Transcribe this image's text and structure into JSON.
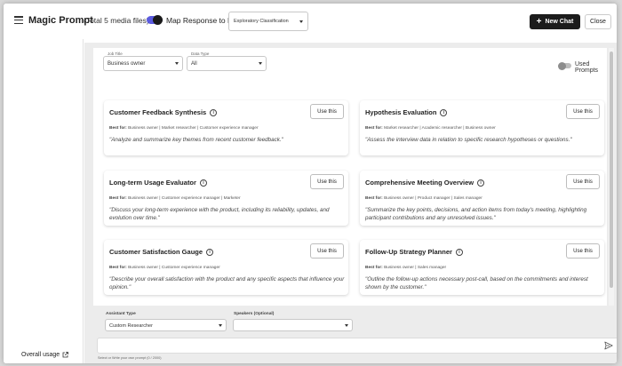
{
  "header": {
    "title": "Magic Prompt",
    "count": "(Total 5 media files)",
    "map_label": "Map Response to Field",
    "field_select": "Exploratory Classification",
    "new_chat": "New Chat",
    "close": "Close"
  },
  "sidebar": {
    "overall_usage": "Overall usage"
  },
  "filters": {
    "job_title_label": "Job Title",
    "job_title_value": "Business owner",
    "data_type_label": "Data Type",
    "data_type_value": "All",
    "used_prompts": "Used Prompts"
  },
  "common": {
    "use_label": "Use this",
    "best_for_label": "Best for:"
  },
  "cards": [
    {
      "title": "Customer Feedback Synthesis",
      "best_for": "Business owner | Market researcher | Customer experience manager",
      "desc": "\"Analyze and summarize key themes from recent customer feedback.\""
    },
    {
      "title": "Hypothesis Evaluation",
      "best_for": "Market researcher | Academic researcher | Business owner",
      "desc": "\"Assess the interview data in relation to specific research hypotheses or questions.\""
    },
    {
      "title": "Long-term Usage Evaluator",
      "best_for": "Business owner | Customer experience manager | Marketer",
      "desc": "\"Discuss your long-term experience with the product, including its reliability, updates, and evolution over time.\""
    },
    {
      "title": "Comprehensive Meeting Overview",
      "best_for": "Business owner | Product manager | Sales manager",
      "desc": "\"Summarize the key points, decisions, and action items from today's meeting, highlighting participant contributions and any unresolved issues.\""
    },
    {
      "title": "Customer Satisfaction Gauge",
      "best_for": "Business owner | Customer experience manager",
      "desc": "\"Describe your overall satisfaction with the product and any specific aspects that influence your opinion.\""
    },
    {
      "title": "Follow-Up Strategy Planner",
      "best_for": "Business owner | Sales manager",
      "desc": "\"Outline the follow-up actions necessary post-call, based on the commitments and interest shown by the customer.\""
    }
  ],
  "bottom": {
    "assistant_type_label": "Assistant Type",
    "assistant_type_value": "Custom Researcher",
    "speakers_label": "Speakers (Optional)",
    "speakers_value": "",
    "hint": "Select or Write your own prompt (0 / 2000)"
  }
}
